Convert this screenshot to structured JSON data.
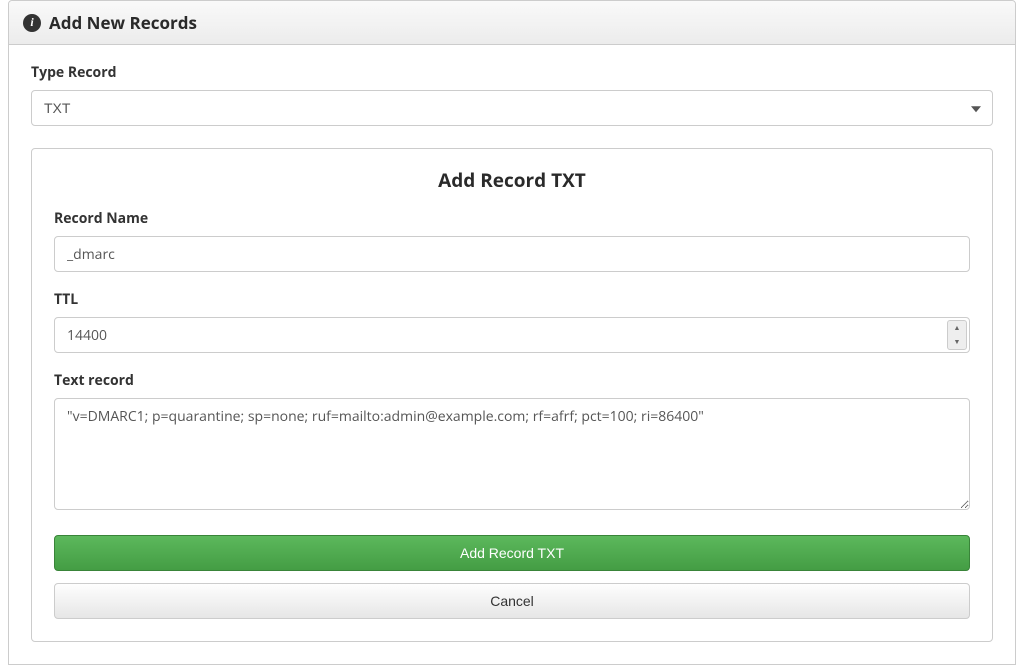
{
  "header": {
    "title": "Add New Records"
  },
  "type_record": {
    "label": "Type Record",
    "value": "TXT"
  },
  "form": {
    "title": "Add Record TXT",
    "record_name": {
      "label": "Record Name",
      "value": "_dmarc"
    },
    "ttl": {
      "label": "TTL",
      "value": "14400"
    },
    "text_record": {
      "label": "Text record",
      "value": "\"v=DMARC1; p=quarantine; sp=none; ruf=mailto:admin@example.com; rf=afrf; pct=100; ri=86400\""
    }
  },
  "buttons": {
    "submit": "Add Record TXT",
    "cancel": "Cancel"
  }
}
